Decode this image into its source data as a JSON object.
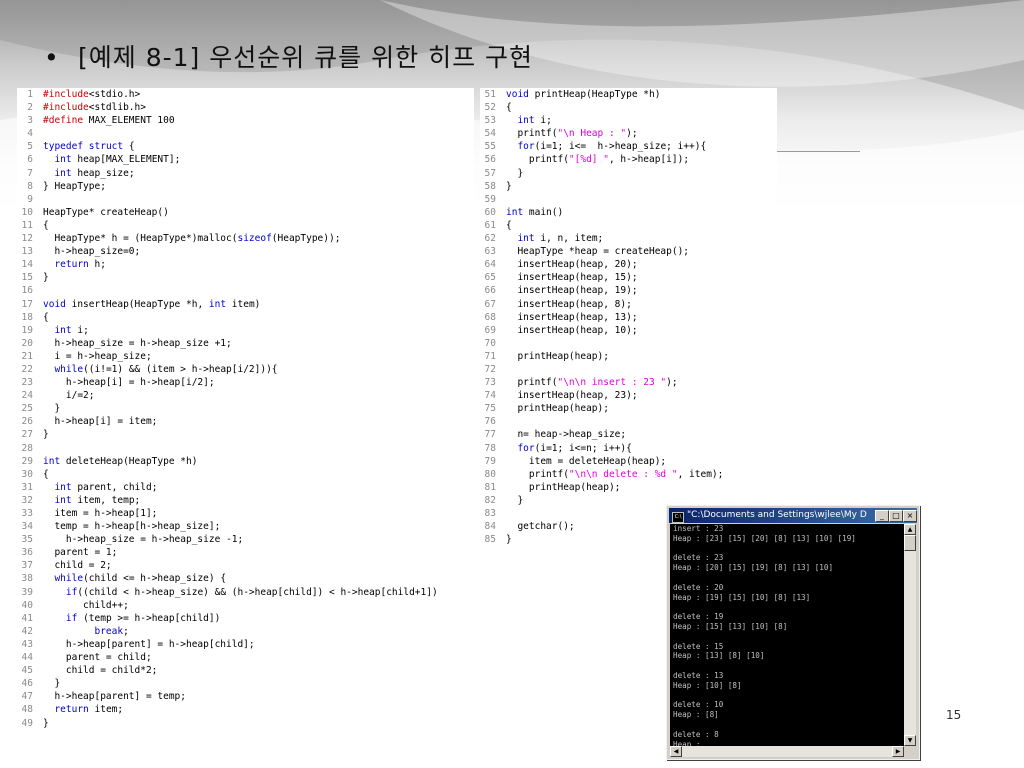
{
  "slide": {
    "bullet": "•",
    "title": "[예제 8-1] 우선순위 큐를 위한 히프 구현",
    "page_number": "15"
  },
  "code_left": [
    {
      "n": "1",
      "t": [
        [
          "pp",
          "#include"
        ],
        [
          "",
          "<stdio.h>"
        ]
      ]
    },
    {
      "n": "2",
      "t": [
        [
          "pp",
          "#include"
        ],
        [
          "",
          "<stdlib.h>"
        ]
      ]
    },
    {
      "n": "3",
      "t": [
        [
          "pp",
          "#define"
        ],
        [
          "",
          " MAX_ELEMENT 100"
        ]
      ]
    },
    {
      "n": "4",
      "t": []
    },
    {
      "n": "5",
      "t": [
        [
          "kw",
          "typedef"
        ],
        [
          "",
          " "
        ],
        [
          "kw",
          "struct"
        ],
        [
          "",
          " {"
        ]
      ]
    },
    {
      "n": "6",
      "t": [
        [
          "",
          "  "
        ],
        [
          "kw",
          "int"
        ],
        [
          "",
          " heap[MAX_ELEMENT];"
        ]
      ]
    },
    {
      "n": "7",
      "t": [
        [
          "",
          "  "
        ],
        [
          "kw",
          "int"
        ],
        [
          "",
          " heap_size;"
        ]
      ]
    },
    {
      "n": "8",
      "t": [
        [
          "",
          "} HeapType;"
        ]
      ]
    },
    {
      "n": "9",
      "t": []
    },
    {
      "n": "10",
      "t": [
        [
          "",
          "HeapType* createHeap()"
        ]
      ]
    },
    {
      "n": "11",
      "t": [
        [
          "",
          "{"
        ]
      ]
    },
    {
      "n": "12",
      "t": [
        [
          "",
          "  HeapType* h = (HeapType*)malloc("
        ],
        [
          "kw",
          "sizeof"
        ],
        [
          "",
          "(HeapType));"
        ]
      ]
    },
    {
      "n": "13",
      "t": [
        [
          "",
          "  h->heap_size=0;"
        ]
      ]
    },
    {
      "n": "14",
      "t": [
        [
          "",
          "  "
        ],
        [
          "kw",
          "return"
        ],
        [
          "",
          " h;"
        ]
      ]
    },
    {
      "n": "15",
      "t": [
        [
          "",
          "}"
        ]
      ]
    },
    {
      "n": "16",
      "t": []
    },
    {
      "n": "17",
      "t": [
        [
          "kw",
          "void"
        ],
        [
          "",
          " insertHeap(HeapType *h, "
        ],
        [
          "kw",
          "int"
        ],
        [
          "",
          " item)"
        ]
      ]
    },
    {
      "n": "18",
      "t": [
        [
          "",
          "{"
        ]
      ]
    },
    {
      "n": "19",
      "t": [
        [
          "",
          "  "
        ],
        [
          "kw",
          "int"
        ],
        [
          "",
          " i;"
        ]
      ]
    },
    {
      "n": "20",
      "t": [
        [
          "",
          "  h->heap_size = h->heap_size +1;"
        ]
      ]
    },
    {
      "n": "21",
      "t": [
        [
          "",
          "  i = h->heap_size;"
        ]
      ]
    },
    {
      "n": "22",
      "t": [
        [
          "",
          "  "
        ],
        [
          "kw",
          "while"
        ],
        [
          "",
          "((i!=1) && (item > h->heap[i/2])){"
        ]
      ]
    },
    {
      "n": "23",
      "t": [
        [
          "",
          "    h->heap[i] = h->heap[i/2];"
        ]
      ]
    },
    {
      "n": "24",
      "t": [
        [
          "",
          "    i/=2;"
        ]
      ]
    },
    {
      "n": "25",
      "t": [
        [
          "",
          "  }"
        ]
      ]
    },
    {
      "n": "26",
      "t": [
        [
          "",
          "  h->heap[i] = item;"
        ]
      ]
    },
    {
      "n": "27",
      "t": [
        [
          "",
          "}"
        ]
      ]
    },
    {
      "n": "28",
      "t": []
    },
    {
      "n": "29",
      "t": [
        [
          "kw",
          "int"
        ],
        [
          "",
          " deleteHeap(HeapType *h)"
        ]
      ]
    },
    {
      "n": "30",
      "t": [
        [
          "",
          "{"
        ]
      ]
    },
    {
      "n": "31",
      "t": [
        [
          "",
          "  "
        ],
        [
          "kw",
          "int"
        ],
        [
          "",
          " parent, child;"
        ]
      ]
    },
    {
      "n": "32",
      "t": [
        [
          "",
          "  "
        ],
        [
          "kw",
          "int"
        ],
        [
          "",
          " item, temp;"
        ]
      ]
    },
    {
      "n": "33",
      "t": [
        [
          "",
          "  item = h->heap[1];"
        ]
      ]
    },
    {
      "n": "34",
      "t": [
        [
          "",
          "  temp = h->heap[h->heap_size];"
        ]
      ]
    },
    {
      "n": "35",
      "t": [
        [
          "",
          "    h->heap_size = h->heap_size -1;"
        ]
      ]
    },
    {
      "n": "36",
      "t": [
        [
          "",
          "  parent = 1;"
        ]
      ]
    },
    {
      "n": "37",
      "t": [
        [
          "",
          "  child = 2;"
        ]
      ]
    },
    {
      "n": "38",
      "t": [
        [
          "",
          "  "
        ],
        [
          "kw",
          "while"
        ],
        [
          "",
          "(child <= h->heap_size) {"
        ]
      ]
    },
    {
      "n": "39",
      "t": [
        [
          "",
          "    "
        ],
        [
          "kw",
          "if"
        ],
        [
          "",
          "((child < h->heap_size) && (h->heap[child]) < h->heap[child+1])"
        ]
      ]
    },
    {
      "n": "40",
      "t": [
        [
          "",
          "       child++;"
        ]
      ]
    },
    {
      "n": "41",
      "t": [
        [
          "",
          "    "
        ],
        [
          "kw",
          "if"
        ],
        [
          "",
          " (temp >= h->heap[child])"
        ]
      ]
    },
    {
      "n": "42",
      "t": [
        [
          "",
          "         "
        ],
        [
          "kw",
          "break"
        ],
        [
          "",
          ";"
        ]
      ]
    },
    {
      "n": "43",
      "t": [
        [
          "",
          "    h->heap[parent] = h->heap[child];"
        ]
      ]
    },
    {
      "n": "44",
      "t": [
        [
          "",
          "    parent = child;"
        ]
      ]
    },
    {
      "n": "45",
      "t": [
        [
          "",
          "    child = child*2;"
        ]
      ]
    },
    {
      "n": "46",
      "t": [
        [
          "",
          "  }"
        ]
      ]
    },
    {
      "n": "47",
      "t": [
        [
          "",
          "  h->heap[parent] = temp;"
        ]
      ]
    },
    {
      "n": "48",
      "t": [
        [
          "",
          "  "
        ],
        [
          "kw",
          "return"
        ],
        [
          "",
          " item;"
        ]
      ]
    },
    {
      "n": "49",
      "t": [
        [
          "",
          "}"
        ]
      ]
    }
  ],
  "code_right": [
    {
      "n": "51",
      "t": [
        [
          "kw",
          "void"
        ],
        [
          "",
          " printHeap(HeapType *h)"
        ]
      ]
    },
    {
      "n": "52",
      "t": [
        [
          "",
          "{"
        ]
      ]
    },
    {
      "n": "53",
      "t": [
        [
          "",
          "  "
        ],
        [
          "kw",
          "int"
        ],
        [
          "",
          " i;"
        ]
      ]
    },
    {
      "n": "54",
      "t": [
        [
          "",
          "  printf("
        ],
        [
          "st",
          "\"\\n Heap : \""
        ],
        [
          "",
          ");"
        ]
      ]
    },
    {
      "n": "55",
      "t": [
        [
          "",
          "  "
        ],
        [
          "kw",
          "for"
        ],
        [
          "",
          "(i=1; i<=  h->heap_size; i++){"
        ]
      ]
    },
    {
      "n": "56",
      "t": [
        [
          "",
          "    printf("
        ],
        [
          "st",
          "\"[%d] \""
        ],
        [
          "",
          ", h->heap[i]);"
        ]
      ]
    },
    {
      "n": "57",
      "t": [
        [
          "",
          "  }"
        ]
      ]
    },
    {
      "n": "58",
      "t": [
        [
          "",
          "}"
        ]
      ]
    },
    {
      "n": "59",
      "t": []
    },
    {
      "n": "60",
      "t": [
        [
          "kw",
          "int"
        ],
        [
          "",
          " main()"
        ]
      ]
    },
    {
      "n": "61",
      "t": [
        [
          "",
          "{"
        ]
      ]
    },
    {
      "n": "62",
      "t": [
        [
          "",
          "  "
        ],
        [
          "kw",
          "int"
        ],
        [
          "",
          " i, n, item;"
        ]
      ]
    },
    {
      "n": "63",
      "t": [
        [
          "",
          "  HeapType *heap = createHeap();"
        ]
      ]
    },
    {
      "n": "64",
      "t": [
        [
          "",
          "  insertHeap(heap, 20);"
        ]
      ]
    },
    {
      "n": "65",
      "t": [
        [
          "",
          "  insertHeap(heap, 15);"
        ]
      ]
    },
    {
      "n": "66",
      "t": [
        [
          "",
          "  insertHeap(heap, 19);"
        ]
      ]
    },
    {
      "n": "67",
      "t": [
        [
          "",
          "  insertHeap(heap, 8);"
        ]
      ]
    },
    {
      "n": "68",
      "t": [
        [
          "",
          "  insertHeap(heap, 13);"
        ]
      ]
    },
    {
      "n": "69",
      "t": [
        [
          "",
          "  insertHeap(heap, 10);"
        ]
      ]
    },
    {
      "n": "70",
      "t": []
    },
    {
      "n": "71",
      "t": [
        [
          "",
          "  printHeap(heap);"
        ]
      ]
    },
    {
      "n": "72",
      "t": []
    },
    {
      "n": "73",
      "t": [
        [
          "",
          "  printf("
        ],
        [
          "st",
          "\"\\n\\n insert : 23 \""
        ],
        [
          "",
          ");"
        ]
      ]
    },
    {
      "n": "74",
      "t": [
        [
          "",
          "  insertHeap(heap, 23);"
        ]
      ]
    },
    {
      "n": "75",
      "t": [
        [
          "",
          "  printHeap(heap);"
        ]
      ]
    },
    {
      "n": "76",
      "t": []
    },
    {
      "n": "77",
      "t": [
        [
          "",
          "  n= heap->heap_size;"
        ]
      ]
    },
    {
      "n": "78",
      "t": [
        [
          "",
          "  "
        ],
        [
          "kw",
          "for"
        ],
        [
          "",
          "(i=1; i<=n; i++){"
        ]
      ]
    },
    {
      "n": "79",
      "t": [
        [
          "",
          "    item = deleteHeap(heap);"
        ]
      ]
    },
    {
      "n": "80",
      "t": [
        [
          "",
          "    printf("
        ],
        [
          "st",
          "\"\\n\\n delete : %d \""
        ],
        [
          "",
          ", item);"
        ]
      ]
    },
    {
      "n": "81",
      "t": [
        [
          "",
          "    printHeap(heap);"
        ]
      ]
    },
    {
      "n": "82",
      "t": [
        [
          "",
          "  }"
        ]
      ]
    },
    {
      "n": "83",
      "t": []
    },
    {
      "n": "84",
      "t": [
        [
          "",
          "  getchar();"
        ]
      ]
    },
    {
      "n": "85",
      "t": [
        [
          "",
          "}"
        ]
      ]
    }
  ],
  "console": {
    "title": "\"C:\\Documents and Settings\\wjlee\\My D...",
    "buttons": {
      "minimize": "_",
      "maximize": "□",
      "close": "×"
    },
    "output": "insert : 23\nHeap : [23] [15] [20] [8] [13] [10] [19]\n\ndelete : 23\nHeap : [20] [15] [19] [8] [13] [10]\n\ndelete : 20\nHeap : [19] [15] [10] [8] [13]\n\ndelete : 19\nHeap : [15] [13] [10] [8]\n\ndelete : 15\nHeap : [13] [8] [10]\n\ndelete : 13\nHeap : [10] [8]\n\ndelete : 10\nHeap : [8]\n\ndelete : 8\nHeap :"
  },
  "colors": {
    "keyword": "#0000cc",
    "preprocessor": "#cc0000",
    "string": "#e000e0",
    "console_titlebar": "#0a246a"
  }
}
